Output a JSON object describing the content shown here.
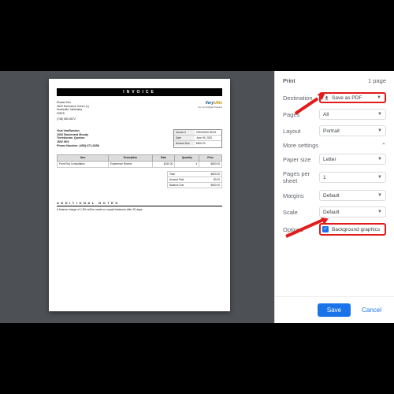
{
  "invoice": {
    "title": "INVOICE",
    "company": {
      "name": "Rowan Kim",
      "addr1": "3620 Hermance Green (1)",
      "city": "Huntsville, Nebraska",
      "zip": "20878",
      "phone": "(748) 680-5872"
    },
    "brand": {
      "part1": "Very",
      "part2": "Utils",
      "tagline": "For Your Digital Products"
    },
    "bill_to": {
      "name": "Viva VonRueden",
      "street": "1092 Boulevard Moody",
      "city": "Terrebonne, Quebec",
      "code": "J6W 3K9",
      "phone_label": "Phone Number:",
      "phone": "(450) 471-0358"
    },
    "meta": {
      "invno_k": "Invoice #",
      "invno_v": "032000040 INV01",
      "date_k": "Date",
      "date_v": "June 09, 2022",
      "due_k": "Amount Due",
      "due_v": "$600.00"
    },
    "table": {
      "h1": "Item",
      "h2": "Description",
      "h3": "Rate",
      "h4": "Quantity",
      "h5": "Price",
      "r1": {
        "item": "Front End Consultation",
        "desc": "Experience Review",
        "rate": "$150.00",
        "qty": "4",
        "price": "$600.00"
      }
    },
    "totals": {
      "total_k": "Total",
      "total_v": "$600.00",
      "paid_k": "Amount Paid",
      "paid_v": "$0.00",
      "bal_k": "Balance Due",
      "bal_v": "$600.00"
    },
    "notes_h": "ADDITIONAL NOTES",
    "notes_t": "A finance charge of 1.5% will be made on unpaid balances after 30 days."
  },
  "panel": {
    "title": "Print",
    "page_count": "1 page",
    "destination_label": "Destination",
    "destination_value": "Save as PDF",
    "pages_label": "Pages",
    "pages_value": "All",
    "layout_label": "Layout",
    "layout_value": "Portrait",
    "more_label": "More settings",
    "paper_label": "Paper size",
    "paper_value": "Letter",
    "pps_label": "Pages per sheet",
    "pps_value": "1",
    "margins_label": "Margins",
    "margins_value": "Default",
    "scale_label": "Scale",
    "scale_value": "Default",
    "options_label": "Options",
    "bg_graphics_label": "Background graphics",
    "save_btn": "Save",
    "cancel_btn": "Cancel"
  }
}
